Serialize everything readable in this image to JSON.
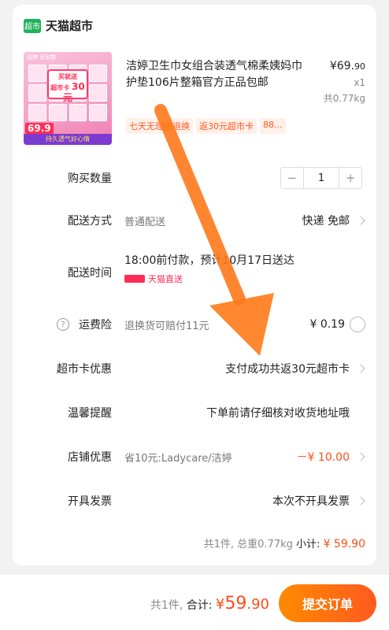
{
  "store": {
    "logo_text": "超市",
    "name": "天猫超市"
  },
  "product": {
    "title": "洁婷卫生巾女组合装透气棉柔姨妈巾护垫106片整箱官方正品包邮",
    "price_main": "¥69.",
    "price_cents": "90",
    "qty": "x1",
    "weight": "共0.77kg",
    "tags": [
      "七天无理由退换",
      "返30元超市卡",
      "88..."
    ],
    "thumb": {
      "brand": "洁婷 军划算",
      "promo_top": "买就送",
      "promo_mid": "超市卡",
      "promo_amount": "30元",
      "price": "69.9",
      "slogan": "持久透气好心情"
    }
  },
  "rows": {
    "quantity": {
      "label": "购买数量",
      "minus": "−",
      "value": "1",
      "plus": "+"
    },
    "delivery": {
      "label": "配送方式",
      "left": "普通配送",
      "right": "快递 免邮"
    },
    "delivery_time": {
      "label": "配送时间",
      "text": "18:00前付款，预计10月17日送达",
      "badge": "天猫直送"
    },
    "insurance": {
      "label": "运费险",
      "icon": "?",
      "left": "退换货可赔付11元",
      "right": "¥ 0.19"
    },
    "market_card": {
      "label": "超市卡优惠",
      "right": "支付成功共返30元超市卡"
    },
    "reminder": {
      "label": "温馨提醒",
      "right": "下单前请仔细核对收货地址哦"
    },
    "shop_discount": {
      "label": "店铺优惠",
      "left": "省10元:Ladycare/洁婷",
      "right": "－¥ 10.00"
    },
    "invoice": {
      "label": "开具发票",
      "right": "本次不开具发票"
    }
  },
  "subtotal": {
    "summary": "共1件, 总重0.77kg",
    "label": "小计:",
    "amount": "¥ 59.90"
  },
  "footer": {
    "count": "共1件,",
    "label": "合计:",
    "currency": "¥",
    "amount_int": "59",
    "amount_dec": ".90",
    "submit": "提交订单"
  },
  "colors": {
    "accent": "#ff5a1f",
    "brand_green": "#1fb15a",
    "price_red": "#ff4d1a"
  }
}
